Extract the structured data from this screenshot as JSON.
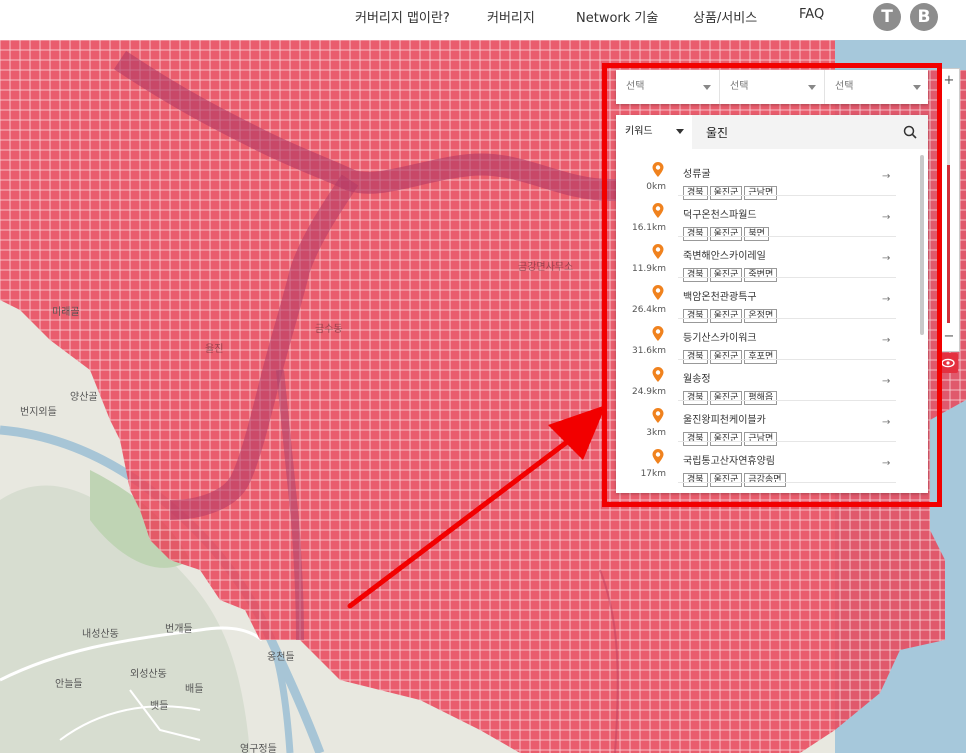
{
  "nav": {
    "items": [
      "커버리지 맵이란?",
      "커버리지",
      "Network 기술",
      "상품/서비스",
      "FAQ"
    ],
    "btn_t": "T",
    "btn_b": "B"
  },
  "map": {
    "labels": [
      "미래골",
      "번지외들",
      "내성산동",
      "번개들",
      "외성산동",
      "안늘들",
      "배들",
      "뱃들",
      "옹천들",
      "영구정들",
      "금강면사무소",
      "양산골",
      "율진",
      "금수동"
    ],
    "coverage_color": "#e8495c",
    "river_color": "#a7c5d6"
  },
  "zoom": {
    "plus": "+",
    "minus": "−"
  },
  "selects": [
    "선택",
    "선택",
    "선택"
  ],
  "search": {
    "type_label": "키워드",
    "query": "울진"
  },
  "results": [
    {
      "name": "성류굴",
      "dist": "0km",
      "tags": [
        "경북",
        "울진군",
        "근남면"
      ]
    },
    {
      "name": "덕구온천스파월드",
      "dist": "16.1km",
      "tags": [
        "경북",
        "울진군",
        "북면"
      ]
    },
    {
      "name": "죽변해안스카이레일",
      "dist": "11.9km",
      "tags": [
        "경북",
        "울진군",
        "죽변면"
      ]
    },
    {
      "name": "백암온천관광특구",
      "dist": "26.4km",
      "tags": [
        "경북",
        "울진군",
        "온정면"
      ]
    },
    {
      "name": "등기산스카이워크",
      "dist": "31.6km",
      "tags": [
        "경북",
        "울진군",
        "후포면"
      ]
    },
    {
      "name": "월송정",
      "dist": "24.9km",
      "tags": [
        "경북",
        "울진군",
        "평해읍"
      ]
    },
    {
      "name": "울진왕피천케이블카",
      "dist": "3km",
      "tags": [
        "경북",
        "울진군",
        "근남면"
      ]
    },
    {
      "name": "국립통고산자연휴양림",
      "dist": "17km",
      "tags": [
        "경북",
        "울진군",
        "금강송면"
      ]
    }
  ],
  "annotation_color": "#f20000"
}
